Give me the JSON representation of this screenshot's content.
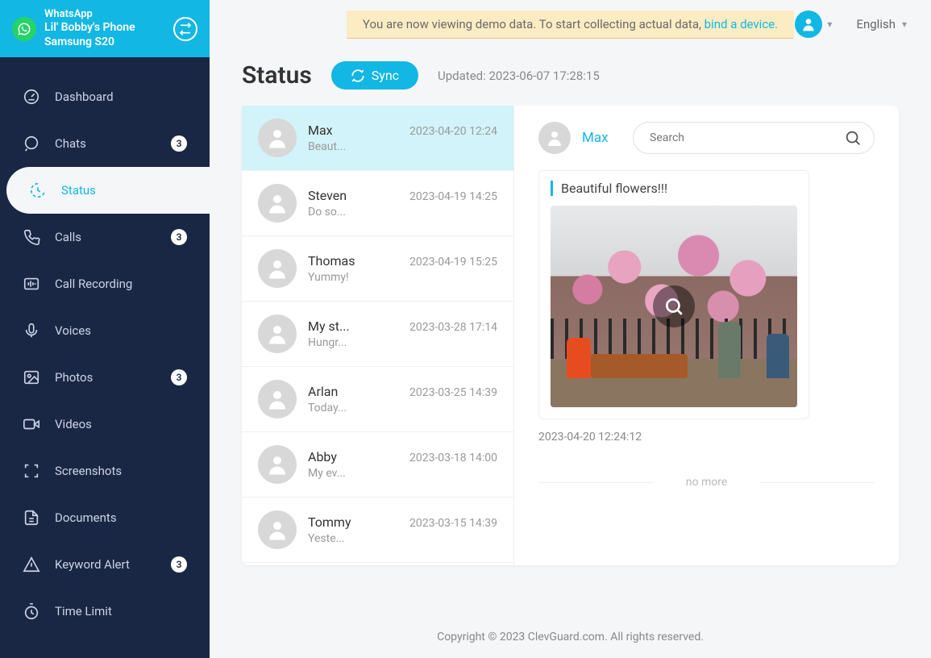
{
  "header": {
    "app": "WhatsApp",
    "device_name": "Lil' Bobby's Phone",
    "device_model": "Samsung S20"
  },
  "banner": {
    "text_before": "You are now viewing demo data. To start collecting actual data, ",
    "link": "bind a device."
  },
  "topbar": {
    "language": "English"
  },
  "nav": {
    "dashboard": "Dashboard",
    "chats": "Chats",
    "chats_badge": "3",
    "status": "Status",
    "calls": "Calls",
    "calls_badge": "3",
    "call_recording": "Call Recording",
    "voices": "Voices",
    "photos": "Photos",
    "photos_badge": "3",
    "videos": "Videos",
    "screenshots": "Screenshots",
    "documents": "Documents",
    "keyword_alert": "Keyword Alert",
    "keyword_badge": "3",
    "time_limit": "Time Limit"
  },
  "page": {
    "title": "Status",
    "sync": "Sync",
    "updated": "Updated: 2023-06-07 17:28:15"
  },
  "status_list": [
    {
      "name": "Max",
      "preview": "Beaut...",
      "time": "2023-04-20 12:24"
    },
    {
      "name": "Steven",
      "preview": "Do so...",
      "time": "2023-04-19 14:25"
    },
    {
      "name": "Thomas",
      "preview": "Yummy!",
      "time": "2023-04-19 15:25"
    },
    {
      "name": "My st...",
      "preview": "Hungr...",
      "time": "2023-03-28 17:14"
    },
    {
      "name": "Arlan",
      "preview": "Today...",
      "time": "2023-03-25 14:39"
    },
    {
      "name": "Abby",
      "preview": "My ev...",
      "time": "2023-03-18 14:00"
    },
    {
      "name": "Tommy",
      "preview": "Yeste...",
      "time": "2023-03-15 14:39"
    }
  ],
  "detail": {
    "name": "Max",
    "search_placeholder": "Search",
    "caption": "Beautiful flowers!!!",
    "timestamp": "2023-04-20 12:24:12",
    "no_more": "no more"
  },
  "footer": "Copyright © 2023 ClevGuard.com. All rights reserved."
}
